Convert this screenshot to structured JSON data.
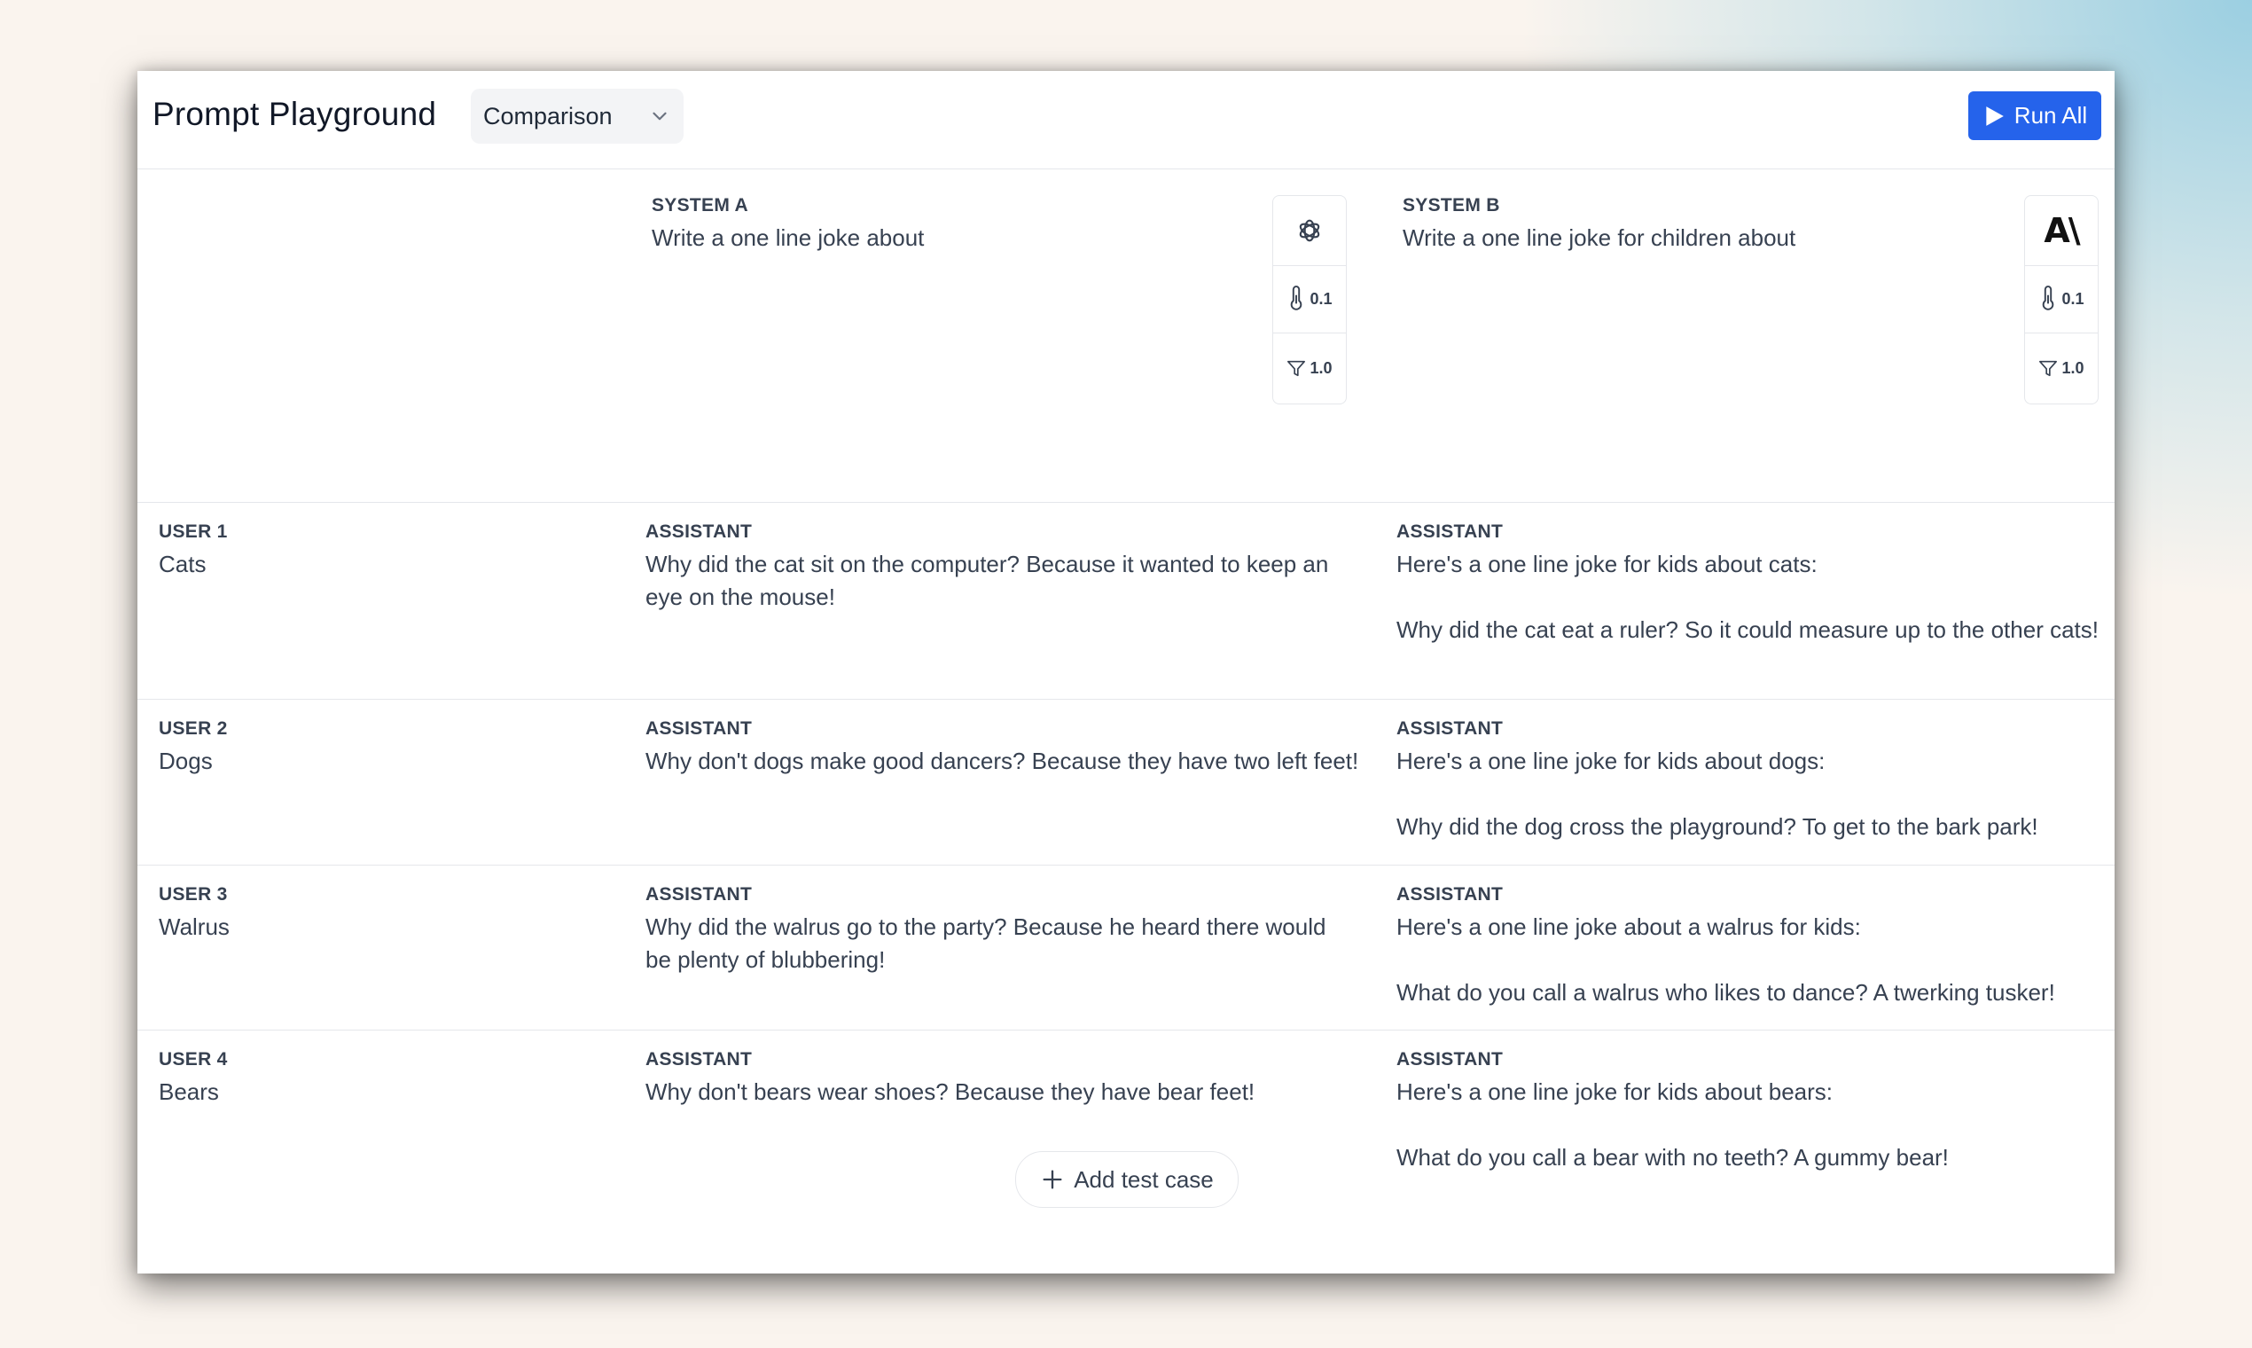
{
  "header": {
    "title": "Prompt Playground",
    "mode_select": {
      "value": "Comparison"
    },
    "run_all_label": "Run All"
  },
  "systems": [
    {
      "label": "SYSTEM A",
      "prompt": "Write a one line joke about",
      "model_icon": "openai-logo-icon",
      "temperature": "0.1",
      "top_p": "1.0"
    },
    {
      "label": "SYSTEM B",
      "prompt": "Write a one line joke for children about",
      "model_icon": "anthropic-logo-icon",
      "model_logo_text": "A\\",
      "temperature": "0.1",
      "top_p": "1.0"
    }
  ],
  "test_cases": [
    {
      "user_label": "USER 1",
      "user_text": "Cats",
      "a_label": "ASSISTANT",
      "a_text": "Why did the cat sit on the computer? Because it wanted to keep an eye on the mouse!",
      "b_label": "ASSISTANT",
      "b_text": "Here's a one line joke for kids about cats:\n\nWhy did the cat eat a ruler? So it could measure up to the other cats!"
    },
    {
      "user_label": "USER 2",
      "user_text": "Dogs",
      "a_label": "ASSISTANT",
      "a_text": "Why don't dogs make good dancers? Because they have two left feet!",
      "b_label": "ASSISTANT",
      "b_text": "Here's a one line joke for kids about dogs:\n\nWhy did the dog cross the playground? To get to the bark park!"
    },
    {
      "user_label": "USER 3",
      "user_text": "Walrus",
      "a_label": "ASSISTANT",
      "a_text": "Why did the walrus go to the party? Because he heard there would be plenty of blubbering!",
      "b_label": "ASSISTANT",
      "b_text": "Here's a one line joke about a walrus for kids:\n\nWhat do you call a walrus who likes to dance? A twerking tusker!"
    },
    {
      "user_label": "USER 4",
      "user_text": "Bears",
      "a_label": "ASSISTANT",
      "a_text": "Why don't bears wear shoes? Because they have bear feet!",
      "b_label": "ASSISTANT",
      "b_text": "Here's a one line joke for kids about bears:\n\nWhat do you call a bear with no teeth? A gummy bear!"
    }
  ],
  "add_test_case_label": "Add test case",
  "colors": {
    "accent": "#2563eb",
    "border": "#e5e7eb",
    "text": "#374151"
  }
}
